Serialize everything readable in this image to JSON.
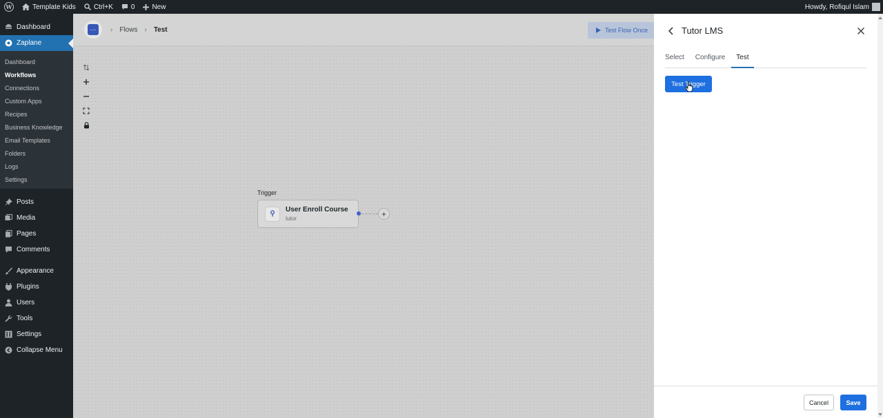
{
  "adminbar": {
    "site_name": "Template Kids",
    "search_shortcut": "Ctrl+K",
    "comments_count": "0",
    "new_label": "New",
    "greeting": "Howdy, Rofiqul Islam"
  },
  "sidebar": {
    "dashboard": "Dashboard",
    "zaplane": "Zaplane",
    "submenu": [
      "Dashboard",
      "Workflows",
      "Connections",
      "Custom Apps",
      "Recipes",
      "Business Knowledge",
      "Email Templates",
      "Folders",
      "Logs",
      "Settings"
    ],
    "posts": "Posts",
    "media": "Media",
    "pages": "Pages",
    "comments": "Comments",
    "appearance": "Appearance",
    "plugins": "Plugins",
    "users": "Users",
    "tools": "Tools",
    "settings": "Settings",
    "collapse": "Collapse Menu"
  },
  "canvas": {
    "breadcrumb": {
      "flows": "Flows",
      "current": "Test"
    },
    "test_flow_button": "Test Flow Once",
    "trigger_label": "Trigger",
    "trigger_card": {
      "title": "User Enroll Course",
      "subtitle": "tutor"
    }
  },
  "panel": {
    "title": "Tutor LMS",
    "tabs": [
      "Select",
      "Configure",
      "Test"
    ],
    "active_tab": "Test",
    "test_trigger_button": "Test Trigger",
    "cancel_button": "Cancel",
    "save_button": "Save"
  },
  "colors": {
    "admin_dark": "#1d2327",
    "wp_blue": "#2271b1",
    "primary_button": "#1e6fe0"
  }
}
